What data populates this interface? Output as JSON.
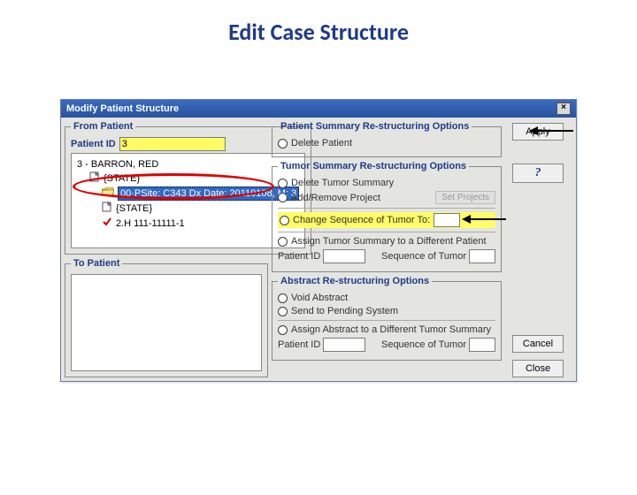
{
  "page_title": "Edit Case Structure",
  "dialog": {
    "title": "Modify Patient Structure",
    "close_glyph": "×"
  },
  "from_patient": {
    "legend": "From Patient",
    "id_label": "Patient ID",
    "id_value": "3",
    "tree": {
      "root": "3 - BARRON, RED",
      "state1": "{STATE}",
      "tumor": "00·PSite: C343  Dx Date: 20110108, M: 3",
      "state2": "{STATE}",
      "abstract": "2.H 111-11111-1"
    }
  },
  "to_patient": {
    "legend": "To Patient"
  },
  "patient_opts": {
    "legend": "Patient Summary Re-structuring Options",
    "delete_patient": "Delete Patient"
  },
  "tumor_opts": {
    "legend": "Tumor Summary Re-structuring Options",
    "delete_tumor": "Delete Tumor Summary",
    "add_remove_proj": "Add/Remove Project",
    "set_projects_btn": "Set Projects",
    "change_seq": "Change Sequence of Tumor To:",
    "assign_tumor": "Assign Tumor Summary to a Different Patient",
    "patient_id_label": "Patient ID",
    "seq_label": "Sequence of Tumor"
  },
  "abstract_opts": {
    "legend": "Abstract Re-structuring Options",
    "void_abs": "Void Abstract",
    "send_pending": "Send to Pending System",
    "assign_abs": "Assign Abstract to a Different Tumor Summary",
    "patient_id_label": "Patient ID",
    "seq_label": "Sequence of Tumor"
  },
  "buttons": {
    "apply": "Apply",
    "help": "?",
    "cancel": "Cancel",
    "close": "Close"
  }
}
